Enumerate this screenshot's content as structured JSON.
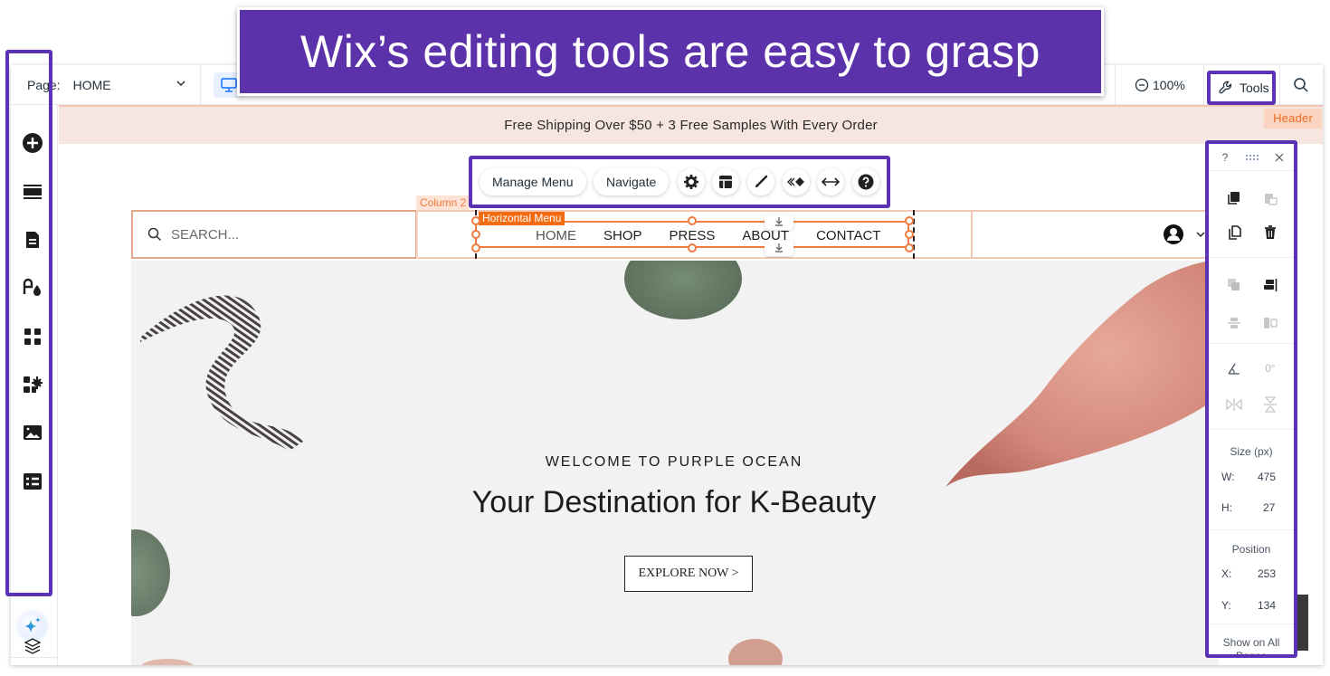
{
  "banner": {
    "title": "Wix’s editing tools are easy to grasp"
  },
  "topbar": {
    "page_label": "Page:",
    "page_value": "HOME",
    "device": "desktop-icon",
    "zoom_value": "100%",
    "tools_label": "Tools"
  },
  "sidebar": {
    "items": [
      {
        "name": "add-elements",
        "icon": "plus-circle-icon"
      },
      {
        "name": "sections",
        "icon": "sections-icon"
      },
      {
        "name": "pages",
        "icon": "page-icon"
      },
      {
        "name": "site-design",
        "icon": "theme-icon"
      },
      {
        "name": "apps",
        "icon": "apps-grid-icon"
      },
      {
        "name": "business-apps",
        "icon": "apps-gear-icon"
      },
      {
        "name": "media",
        "icon": "image-icon"
      },
      {
        "name": "cms",
        "icon": "table-icon"
      }
    ],
    "ai_assistant": "sparkle-icon",
    "layers": "layers-icon"
  },
  "site": {
    "promo": "Free Shipping Over $50 + 3 Free Samples With Every Order",
    "header_tag": "Header",
    "column_tag": "Column 2",
    "search_placeholder": "SEARCH...",
    "menu_tag": "Horizontal Menu",
    "nav": [
      "HOME",
      "SHOP",
      "PRESS",
      "ABOUT",
      "CONTACT"
    ],
    "hero": {
      "kicker": "WELCOME TO PURPLE OCEAN",
      "title": "Your Destination for K-Beauty",
      "cta": "EXPLORE NOW >"
    }
  },
  "floating_toolbar": {
    "manage_menu": "Manage Menu",
    "navigate": "Navigate",
    "icons": [
      "gear-icon",
      "layout-icon",
      "design-brush-icon",
      "animation-icon",
      "stretch-icon",
      "help-icon"
    ]
  },
  "right_panel": {
    "help": "?",
    "size_label": "Size (px)",
    "w_label": "W:",
    "w_value": "475",
    "h_label": "H:",
    "h_value": "27",
    "position_label": "Position",
    "x_label": "X:",
    "x_value": "253",
    "y_label": "Y:",
    "y_value": "134",
    "rotation": "0°",
    "show_all": "Show on All Pages"
  },
  "colors": {
    "highlight": "#5b32b4",
    "selection": "#f07b3f",
    "promo_bg": "#f6e6df"
  }
}
